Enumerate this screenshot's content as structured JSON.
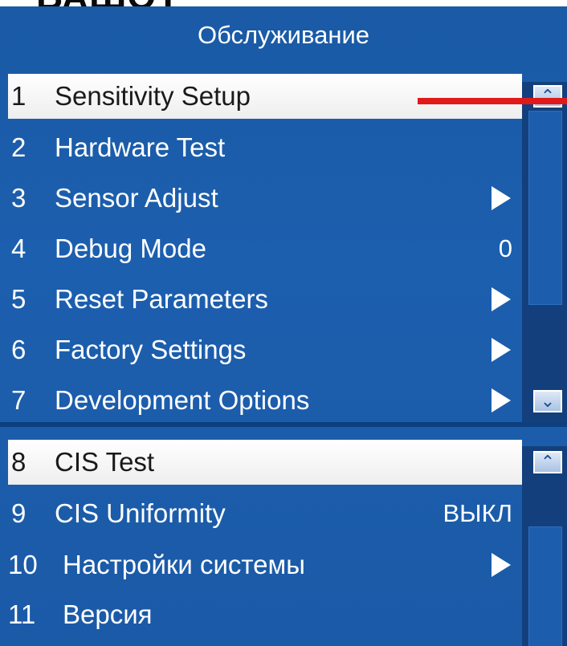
{
  "top_caption": "ВАШОТ",
  "screen": {
    "title": "Обслуживание"
  },
  "menu_top": [
    {
      "num": "1",
      "label": "Sensitivity Setup",
      "value": "",
      "arrow": false,
      "selected": true
    },
    {
      "num": "2",
      "label": "Hardware Test",
      "value": "",
      "arrow": false,
      "selected": false
    },
    {
      "num": "3",
      "label": "Sensor Adjust",
      "value": "",
      "arrow": true,
      "selected": false
    },
    {
      "num": "4",
      "label": "Debug Mode",
      "value": "0",
      "arrow": false,
      "selected": false
    },
    {
      "num": "5",
      "label": "Reset Parameters",
      "value": "",
      "arrow": true,
      "selected": false
    },
    {
      "num": "6",
      "label": "Factory Settings",
      "value": "",
      "arrow": true,
      "selected": false
    },
    {
      "num": "7",
      "label": "Development Options",
      "value": "",
      "arrow": true,
      "selected": false
    }
  ],
  "menu_bottom": [
    {
      "num": "8",
      "label": "CIS Test",
      "value": "",
      "arrow": false,
      "selected": true
    },
    {
      "num": "9",
      "label": "CIS Uniformity",
      "value": "ВЫКЛ",
      "arrow": false,
      "selected": false
    },
    {
      "num": "10",
      "label": "Настройки системы",
      "value": "",
      "arrow": true,
      "selected": false
    },
    {
      "num": "11",
      "label": "Версия",
      "value": "",
      "arrow": false,
      "selected": false
    }
  ],
  "icons": {
    "scroll_up": "chevron-up-icon",
    "scroll_down": "chevron-down-icon",
    "submenu": "triangle-right-icon"
  },
  "colors": {
    "screen_bg": "#1c5fae",
    "highlight": "#ffffff",
    "pointer": "#e0191a"
  }
}
